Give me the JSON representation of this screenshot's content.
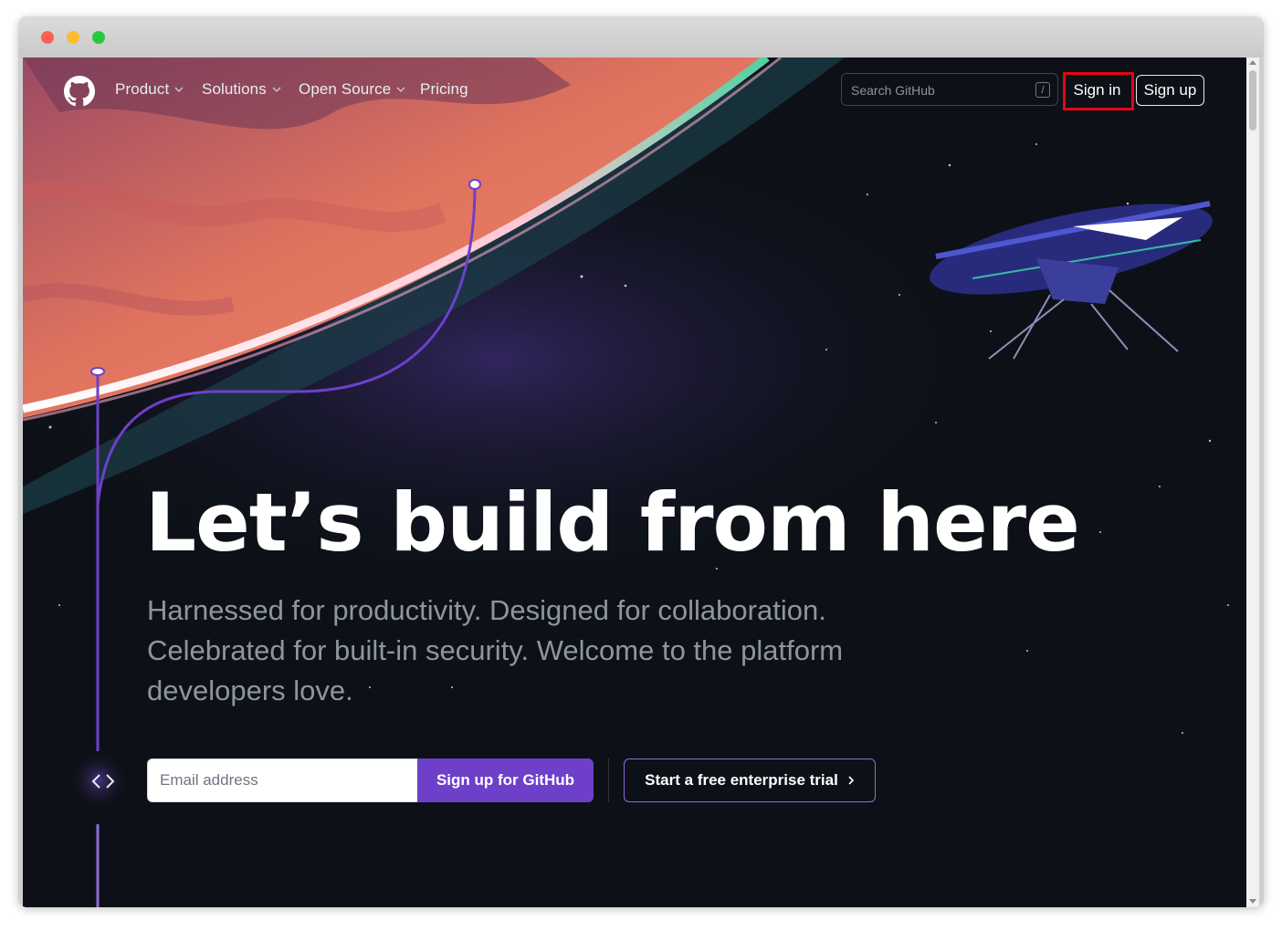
{
  "nav": {
    "items": [
      {
        "label": "Product",
        "dropdown": true
      },
      {
        "label": "Solutions",
        "dropdown": true
      },
      {
        "label": "Open Source",
        "dropdown": true
      },
      {
        "label": "Pricing",
        "dropdown": false
      }
    ],
    "search_placeholder": "Search GitHub",
    "search_shortcut": "/",
    "signin_label": "Sign in",
    "signup_label": "Sign up"
  },
  "hero": {
    "title": "Let’s build from here",
    "subtitle": "Harnessed for productivity. Designed for collaboration. Celebrated for built-in security. Welcome to the platform developers love.",
    "email_placeholder": "Email address",
    "signup_button": "Sign up for GitHub",
    "trial_button": "Start a free enterprise trial"
  },
  "colors": {
    "background": "#0d1117",
    "accent_purple": "#6e40c9",
    "highlight_box": "#e30613",
    "planet": "#e0735e"
  },
  "icons": [
    "github-logo-icon",
    "chevron-down-icon",
    "code-icon",
    "chevron-right-icon"
  ]
}
